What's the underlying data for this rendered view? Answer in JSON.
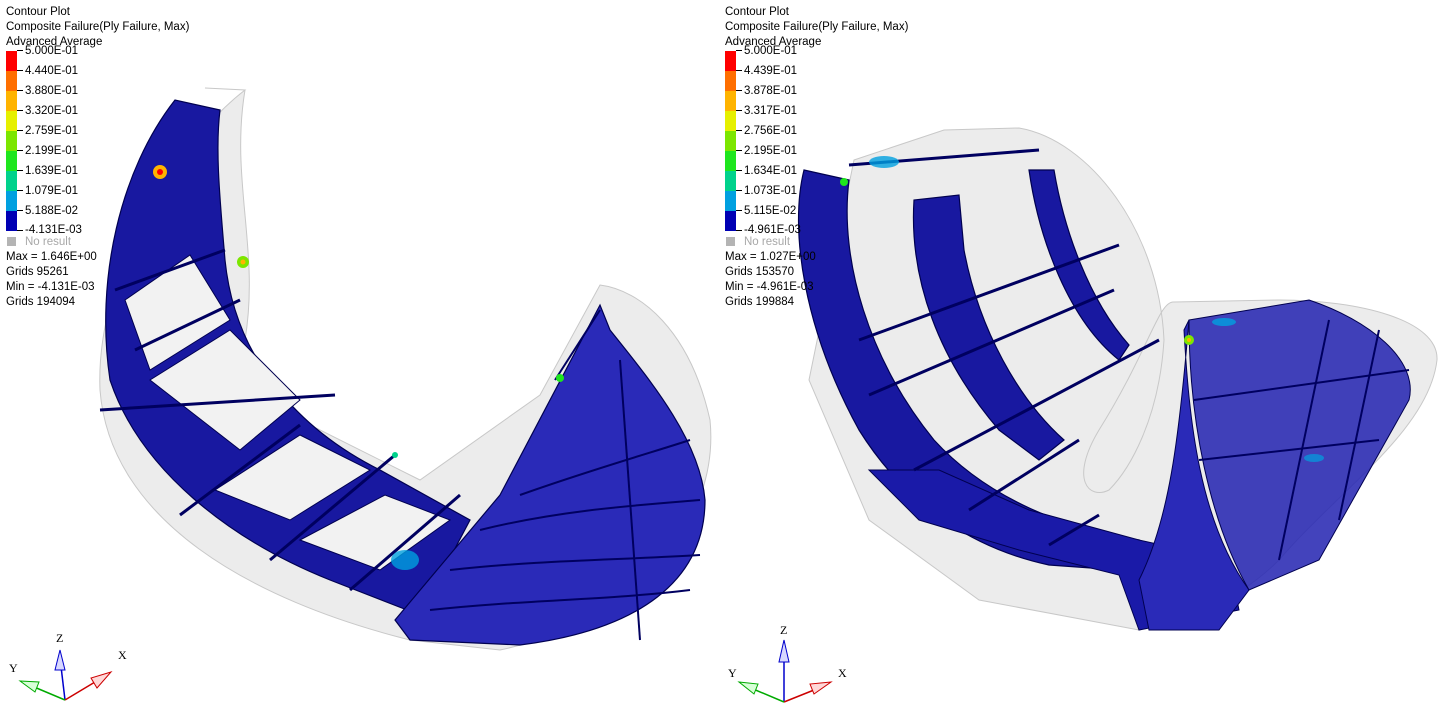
{
  "viewports": [
    {
      "title": "Contour Plot",
      "result": "Composite Failure(Ply Failure, Max)",
      "averaging": "Advanced Average",
      "scale_labels": [
        "5.000E-01",
        "4.440E-01",
        "3.880E-01",
        "3.320E-01",
        "2.759E-01",
        "2.199E-01",
        "1.639E-01",
        "1.079E-01",
        "5.188E-02",
        "-4.131E-03"
      ],
      "no_result": "No result",
      "max": "Max = 1.646E+00",
      "max_grids": "Grids 95261",
      "min": "Min = -4.131E-03",
      "min_grids": "Grids 194094",
      "axes": {
        "x": "X",
        "y": "Y",
        "z": "Z"
      }
    },
    {
      "title": "Contour Plot",
      "result": "Composite Failure(Ply Failure, Max)",
      "averaging": "Advanced Average",
      "scale_labels": [
        "5.000E-01",
        "4.439E-01",
        "3.878E-01",
        "3.317E-01",
        "2.756E-01",
        "2.195E-01",
        "1.634E-01",
        "1.073E-01",
        "5.115E-02",
        "-4.961E-03"
      ],
      "no_result": "No result",
      "max": "Max = 1.027E+00",
      "max_grids": "Grids 153570",
      "min": "Min = -4.961E-03",
      "min_grids": "Grids 199884",
      "axes": {
        "x": "X",
        "y": "Y",
        "z": "Z"
      }
    }
  ],
  "colors": {
    "contour": [
      "#ff0000",
      "#ff6f00",
      "#ffb400",
      "#e6f000",
      "#7ce600",
      "#1ee61e",
      "#00d28c",
      "#00a0e0",
      "#0050ff",
      "#0000b4"
    ],
    "no_result": "#b4b4b4",
    "part_fill": "#1a1aa8",
    "shell_fill": "#dcdcdc"
  }
}
